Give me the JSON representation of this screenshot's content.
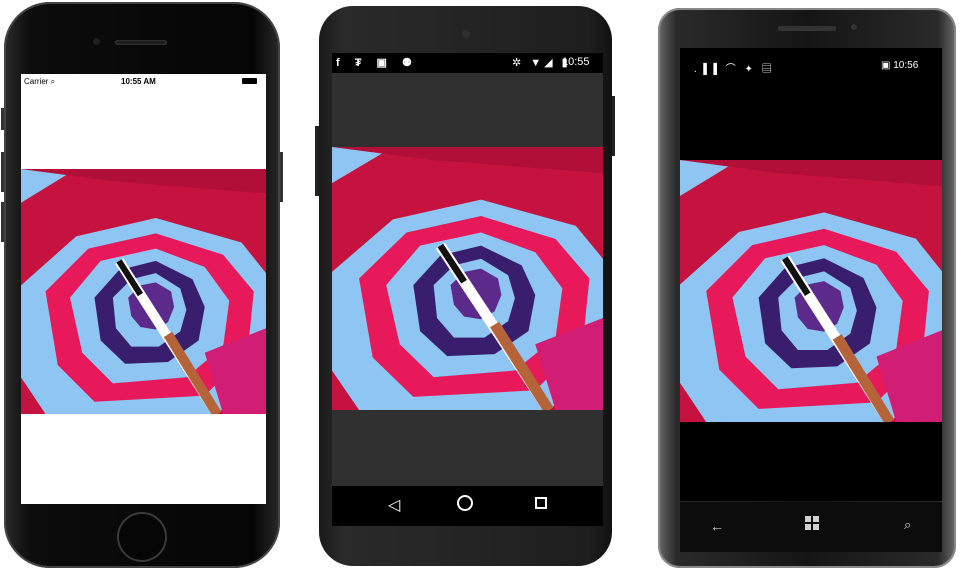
{
  "ios": {
    "carrier": "Carrier ⌕",
    "time": "10:55 AM"
  },
  "android": {
    "status_left": "f ₮ ▣ ⚉",
    "status_right": "✲ ▼◢ ▮",
    "time": "10:55",
    "nav_back": "◁"
  },
  "windows": {
    "status_left": ".▐▐ ⌒ ✦ ▤",
    "time": "▣ 10:56",
    "nav_back": "←",
    "nav_search": "⌕"
  },
  "image": {
    "description": "Hot air balloon interior viewed from below",
    "colors": {
      "red": "#c6123f",
      "pink": "#e8195a",
      "sky": "#8ec5f2",
      "purple": "#3a1e6e",
      "magenta": "#d11e74",
      "pole": "#b5643a"
    }
  }
}
